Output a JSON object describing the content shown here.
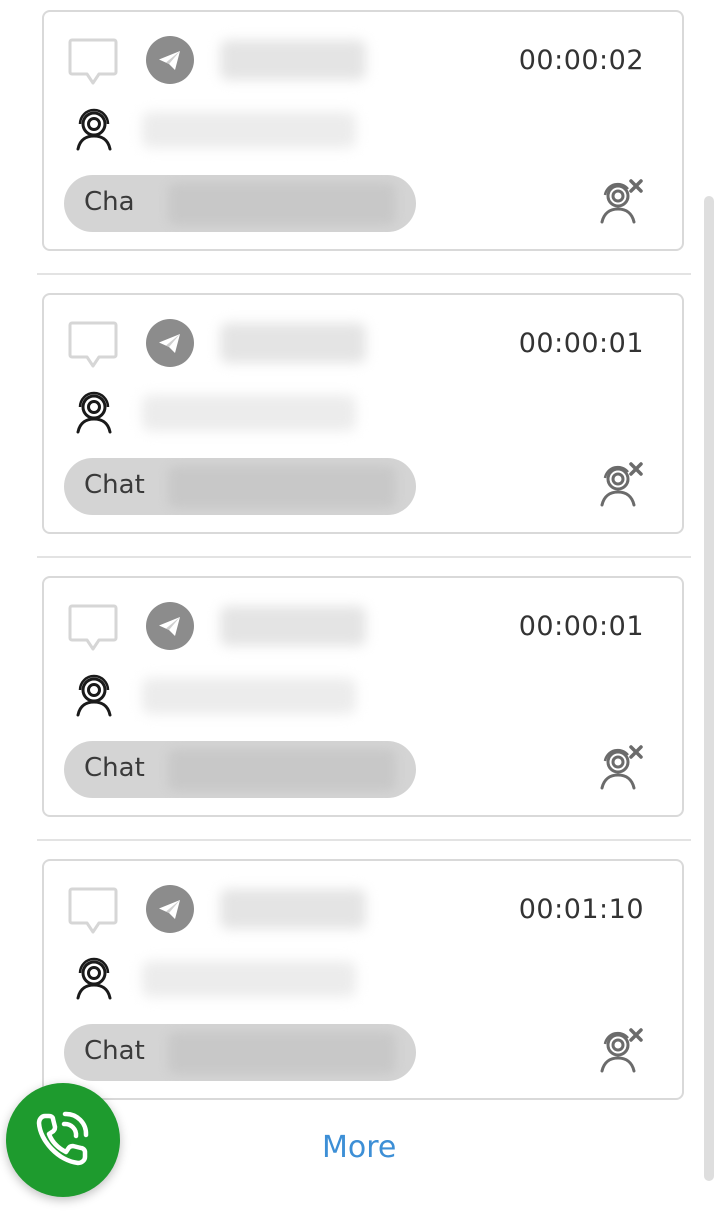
{
  "conversations": [
    {
      "timer": "00:00:02",
      "chat_label": "Cha",
      "channel_icon": "telegram-icon",
      "status_icon": "chat-bubble-icon",
      "agent_icon": "agent-headset-icon",
      "action_icon": "close-chat-icon"
    },
    {
      "timer": "00:00:01",
      "chat_label": "Chat",
      "channel_icon": "telegram-icon",
      "status_icon": "chat-bubble-icon",
      "agent_icon": "agent-headset-icon",
      "action_icon": "close-chat-icon"
    },
    {
      "timer": "00:00:01",
      "chat_label": "Chat",
      "channel_icon": "telegram-icon",
      "status_icon": "chat-bubble-icon",
      "agent_icon": "agent-headset-icon",
      "action_icon": "close-chat-icon"
    },
    {
      "timer": "00:01:10",
      "chat_label": "Chat",
      "channel_icon": "telegram-icon",
      "status_icon": "chat-bubble-icon",
      "agent_icon": "agent-headset-icon",
      "action_icon": "close-chat-icon"
    }
  ],
  "footer": {
    "more_label": "More"
  },
  "fab": {
    "icon": "phone-call-icon"
  },
  "colors": {
    "accent_green": "#1e9b2e",
    "link_blue": "#3d8fd6",
    "telegram_grey": "#8c8c8c",
    "pill_grey": "#d4d4d4",
    "card_border": "#d9d9d9"
  }
}
